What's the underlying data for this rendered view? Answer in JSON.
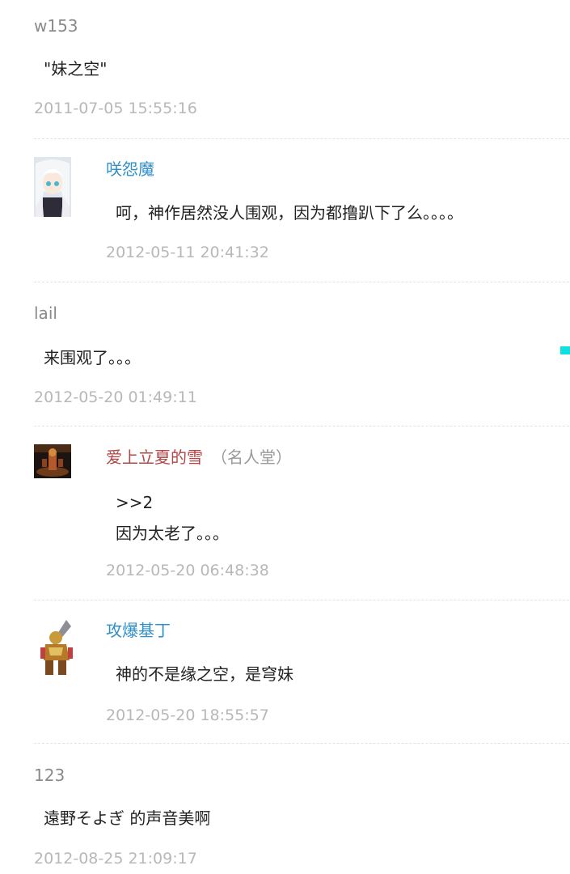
{
  "comments": [
    {
      "name": "w153",
      "text": "\"妹之空\"",
      "time": "2011-07-05 15:55:16"
    },
    {
      "name": "咲怨魔",
      "text": "呵，神作居然没人围观，因为都撸趴下了么。。。。",
      "time": "2012-05-11 20:41:32",
      "avatar": "anime-girl-avatar"
    },
    {
      "name": "lail",
      "text": "来围观了。。。",
      "time": "2012-05-20 01:49:11"
    },
    {
      "name": "爱上立夏的雪",
      "badge": "（名人堂）",
      "text_lines": [
        ">>2",
        "因为太老了。。。"
      ],
      "time": "2012-05-20 06:48:38",
      "avatar": "game-scene-avatar"
    },
    {
      "name": "攻爆基丁",
      "text": "神的不是缘之空，是穹妹",
      "time": "2012-05-20 18:55:57",
      "avatar": "armored-robot-avatar"
    },
    {
      "name": "123",
      "text": "遠野そよぎ 的声音美啊",
      "time": "2012-08-25 21:09:17"
    }
  ],
  "colors": {
    "guest_name": "#8a8a8a",
    "user_name": "#2f8fc9",
    "special_name": "#b24646",
    "time": "#b8b8b8",
    "divider": "#e2e2e2",
    "marker": "#10e0e0"
  }
}
